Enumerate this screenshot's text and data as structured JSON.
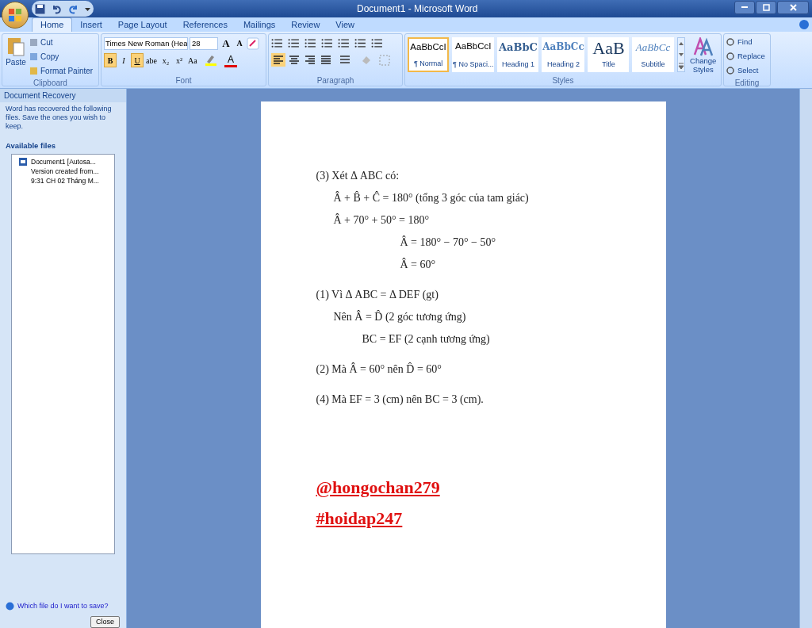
{
  "window": {
    "title": "Document1 - Microsoft Word"
  },
  "tabs": [
    {
      "label": "Home",
      "selected": true
    },
    {
      "label": "Insert",
      "selected": false
    },
    {
      "label": "Page Layout",
      "selected": false
    },
    {
      "label": "References",
      "selected": false
    },
    {
      "label": "Mailings",
      "selected": false
    },
    {
      "label": "Review",
      "selected": false
    },
    {
      "label": "View",
      "selected": false
    }
  ],
  "clipboard": {
    "label": "Clipboard",
    "paste": "Paste",
    "items": [
      "Cut",
      "Copy",
      "Format Painter"
    ]
  },
  "font": {
    "label": "Font",
    "font_name": "Times New Roman (Hea",
    "font_size": "28",
    "grow": "A",
    "shrink": "A",
    "format_buttons": [
      {
        "label": "B",
        "selected": true
      },
      {
        "label": "I",
        "selected": false
      },
      {
        "label": "U",
        "selected": true
      },
      {
        "label": "abe",
        "selected": false
      },
      {
        "label": "x₂",
        "selected": false
      },
      {
        "label": "x²",
        "selected": false
      },
      {
        "label": "Aa",
        "selected": false
      }
    ],
    "font_color": "A"
  },
  "paragraph": {
    "label": "Paragraph",
    "alignments": [
      {
        "selected": true
      },
      {
        "selected": false
      },
      {
        "selected": false
      },
      {
        "selected": false
      }
    ]
  },
  "styles": {
    "label": "Styles",
    "items": [
      {
        "sample": "AaBbCcI",
        "name": "¶ Normal",
        "kind": "normal",
        "selected": true
      },
      {
        "sample": "AaBbCcI",
        "name": "¶ No Spaci...",
        "kind": "normal",
        "selected": false
      },
      {
        "sample": "AaBbC",
        "name": "Heading 1",
        "kind": "heading1",
        "selected": false
      },
      {
        "sample": "AaBbCc",
        "name": "Heading 2",
        "kind": "heading2",
        "selected": false
      },
      {
        "sample": "AaB",
        "name": "Title",
        "kind": "title",
        "selected": false
      },
      {
        "sample": "AaBbCc",
        "name": "Subtitle",
        "kind": "subtitle",
        "selected": false
      }
    ],
    "change": "Change Styles"
  },
  "editing": {
    "label": "Editing",
    "items": [
      "Find",
      "Replace",
      "Select"
    ]
  },
  "recovery": {
    "title": "Document Recovery",
    "message": "Word has recovered the following files.  Save the ones you wish to keep.",
    "available": "Available files",
    "files": [
      {
        "name": "Document1  [Autosa...",
        "version": "Version created from...",
        "time": "9:31 CH 02 Tháng M..."
      }
    ],
    "help": "Which file do I want to save?",
    "close": "Close"
  },
  "document": {
    "lines": [
      {
        "text": "(3) Xét Δ ABC có:",
        "kind": "step"
      },
      {
        "text": "Â + B̂ + Ĉ = 180° (tổng 3 góc của tam giác)",
        "kind": "line"
      },
      {
        "text": "Â + 70° + 50° = 180°",
        "kind": "line"
      },
      {
        "text": "Â = 180° −  70° − 50°",
        "kind": "result"
      },
      {
        "text": "Â = 60°",
        "kind": "result"
      },
      {
        "text": "(1) Vì Δ ABC = Δ DEF (gt)",
        "kind": "step"
      },
      {
        "text": "Nên   Â = D̂ (2 góc tương ứng)",
        "kind": "line"
      },
      {
        "text": "BC = EF (2 cạnh tương ứng)",
        "kind": "sub"
      },
      {
        "text": "(2) Mà  Â = 60° nên D̂ = 60°",
        "kind": "step"
      },
      {
        "text": "(4) Mà EF = 3 (cm) nên BC = 3 (cm).",
        "kind": "step"
      }
    ],
    "signature": [
      "@hongochan279",
      "#hoidap247"
    ]
  }
}
